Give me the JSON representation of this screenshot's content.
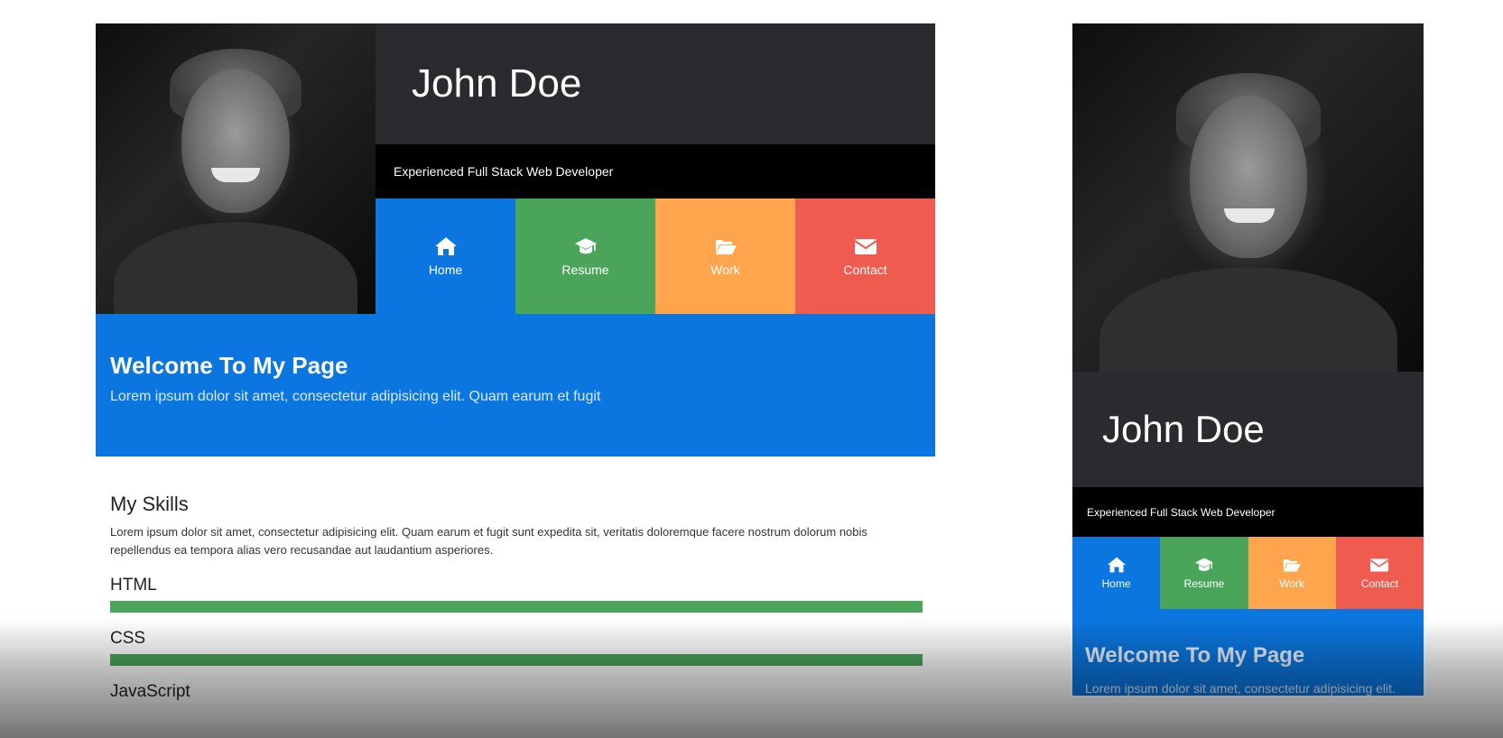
{
  "profile": {
    "name": "John Doe",
    "tagline": "Experienced Full Stack Web Developer"
  },
  "nav": {
    "items": [
      {
        "label": "Home",
        "icon": "home-icon",
        "color": "#0b76df"
      },
      {
        "label": "Resume",
        "icon": "graduation-cap-icon",
        "color": "#4aa55a"
      },
      {
        "label": "Work",
        "icon": "folder-open-icon",
        "color": "#ffa54d"
      },
      {
        "label": "Contact",
        "icon": "envelope-icon",
        "color": "#f05b50"
      }
    ]
  },
  "welcome": {
    "title": "Welcome To My Page",
    "text": "Lorem ipsum dolor sit amet, consectetur adipisicing elit. Quam earum et fugit",
    "mobile_text": "Lorem ipsum dolor sit amet, consectetur adipisicing elit."
  },
  "skills": {
    "title": "My Skills",
    "description": "Lorem ipsum dolor sit amet, consectetur adipisicing elit. Quam earum et fugit sunt expedita sit, veritatis doloremque facere nostrum dolorum nobis repellendus ea tempora alias vero recusandae aut laudantium asperiores.",
    "items": [
      {
        "name": "HTML",
        "level": 1.0
      },
      {
        "name": "CSS",
        "level": 1.0
      },
      {
        "name": "JavaScript",
        "level": null
      }
    ]
  },
  "colors": {
    "primary": "#0b76df",
    "dark": "#2b2b2f",
    "resume": "#4aa55a",
    "work": "#ffa54d",
    "contact": "#f05b50"
  }
}
